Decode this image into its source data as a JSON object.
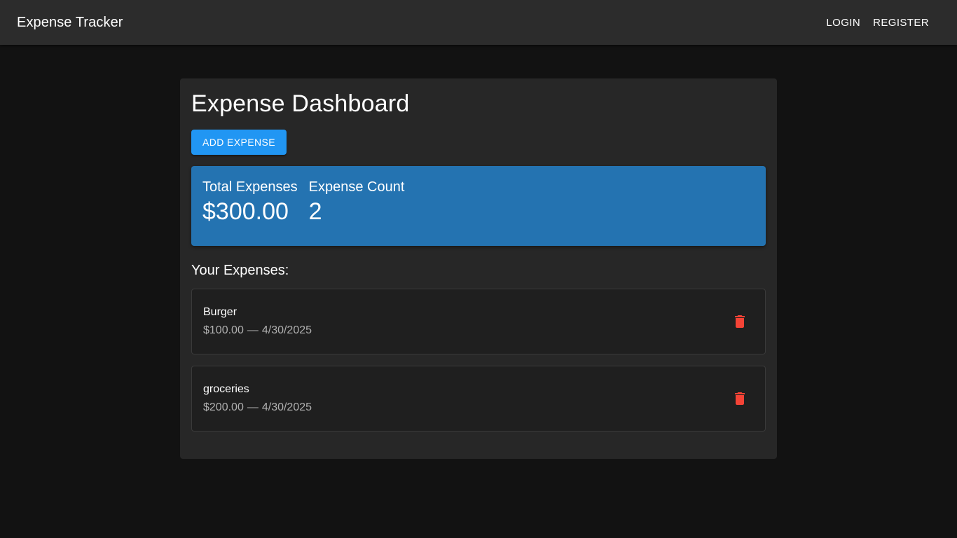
{
  "appbar": {
    "title": "Expense Tracker",
    "nav": [
      {
        "label": "Login"
      },
      {
        "label": "Register"
      }
    ]
  },
  "dashboard": {
    "title": "Expense Dashboard",
    "add_button_label": "Add Expense",
    "summary": {
      "total_label": "Total Expenses",
      "total_value": "$300.00",
      "count_label": "Expense Count",
      "count_value": "2"
    },
    "list_title": "Your Expenses:",
    "expenses": [
      {
        "name": "Burger",
        "amount": "$100.00",
        "separator": "—",
        "date": "4/30/2025"
      },
      {
        "name": "groceries",
        "amount": "$200.00",
        "separator": "—",
        "date": "4/30/2025"
      }
    ]
  },
  "icons": {
    "delete": "trash-icon"
  },
  "colors": {
    "appbar": "#2c2c2c",
    "background": "#121212",
    "panel": "#272727",
    "primary": "#2196f3",
    "summary": "#2473b1",
    "delete": "#f44336"
  }
}
